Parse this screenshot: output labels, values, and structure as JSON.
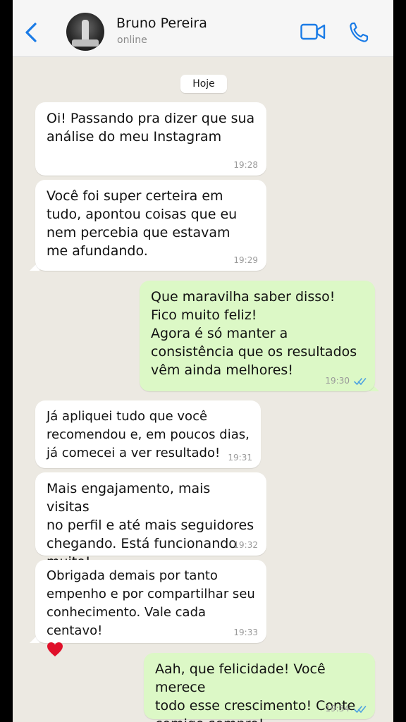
{
  "header": {
    "contact_name": "Bruno Pereira",
    "status": "online"
  },
  "date_chip": "Hoje",
  "messages": [
    {
      "dir": "in",
      "text": "Oi! Passando pra dizer que sua\nanálise do meu Instagram",
      "time": "19:28"
    },
    {
      "dir": "in",
      "text": "Você foi super certeira em\ntudo, apontou coisas que eu\nnem percebia que estavam\nme afundando.",
      "time": "19:29"
    },
    {
      "dir": "out",
      "text": "Que maravilha saber disso!\nFico muito feliz!\nAgora é só manter a\nconsistência que os resultados\nvêm ainda melhores!",
      "time": "19:30"
    },
    {
      "dir": "in",
      "text": "Já apliquei tudo que você\nrecomendou e, em poucos dias,\njá comecei a ver resultado!",
      "time": "19:31"
    },
    {
      "dir": "in",
      "text": "Mais engajamento, mais visitas\nno perfil e até mais seguidores\nchegando. Está funcionando\nmuito!",
      "time": "19:32"
    },
    {
      "dir": "in",
      "text": "Obrigada demais por tanto\nempenho e por compartilhar seu\nconhecimento. Vale cada centavo!",
      "time": "19:33",
      "emoji": "heart-icon"
    },
    {
      "dir": "out",
      "text": "Aah, que felicidade! Você merece\ntodo esse crescimento! Conte\ncomigo sempre!",
      "time": "19:34"
    }
  ],
  "colors": {
    "accent": "#1a7be6",
    "incoming_bubble": "#ffffff",
    "outgoing_bubble": "#dcf8c6",
    "chat_background": "#ece9e2",
    "read_ticks": "#4fa3e0"
  }
}
